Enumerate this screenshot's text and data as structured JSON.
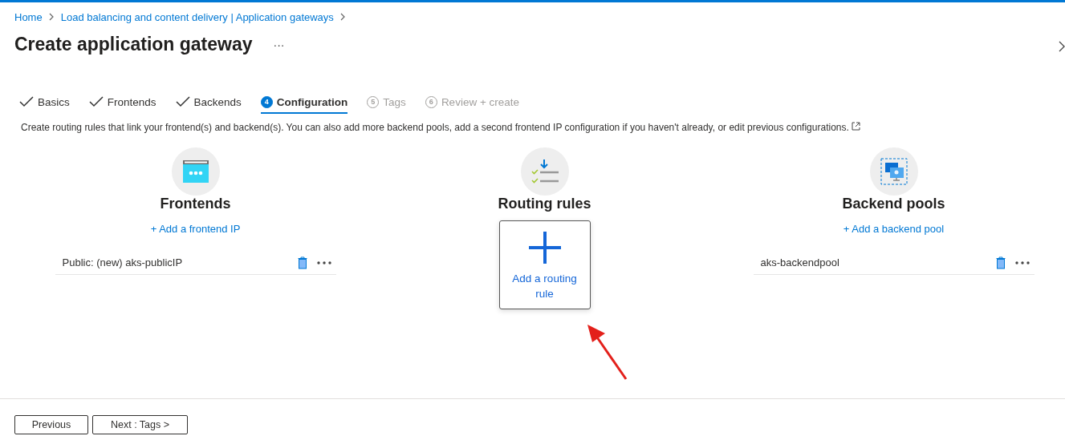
{
  "breadcrumb": [
    "Home",
    "Load balancing and content delivery | Application gateways"
  ],
  "title": "Create application gateway",
  "more": "···",
  "tabs": [
    {
      "kind": "done",
      "label": "Basics",
      "selected": false,
      "disabled": false
    },
    {
      "kind": "done",
      "label": "Frontends",
      "selected": false,
      "disabled": false
    },
    {
      "kind": "done",
      "label": "Backends",
      "selected": false,
      "disabled": false
    },
    {
      "kind": "numbered",
      "number": "4",
      "label": "Configuration",
      "selected": true,
      "disabled": false
    },
    {
      "kind": "numbered",
      "number": "5",
      "label": "Tags",
      "selected": false,
      "disabled": true
    },
    {
      "kind": "numbered",
      "number": "6",
      "label": "Review + create",
      "selected": false,
      "disabled": true
    }
  ],
  "description": "Create routing rules that link your frontend(s) and backend(s). You can also add more backend pools, add a second frontend IP configuration if you haven't already, or edit previous configurations.",
  "columns": [
    {
      "kind": "frontends",
      "heading": "Frontends",
      "add_link": "+ Add a frontend IP",
      "items": [
        "Public: (new) aks-publicIP"
      ]
    },
    {
      "kind": "routing",
      "heading": "Routing rules",
      "add_card": "Add a routing rule"
    },
    {
      "kind": "backends",
      "heading": "Backend pools",
      "add_link": "+ Add a backend pool",
      "items": [
        "aks-backendpool"
      ]
    }
  ],
  "buttons": [
    "Previous",
    "Next : Tags >"
  ]
}
